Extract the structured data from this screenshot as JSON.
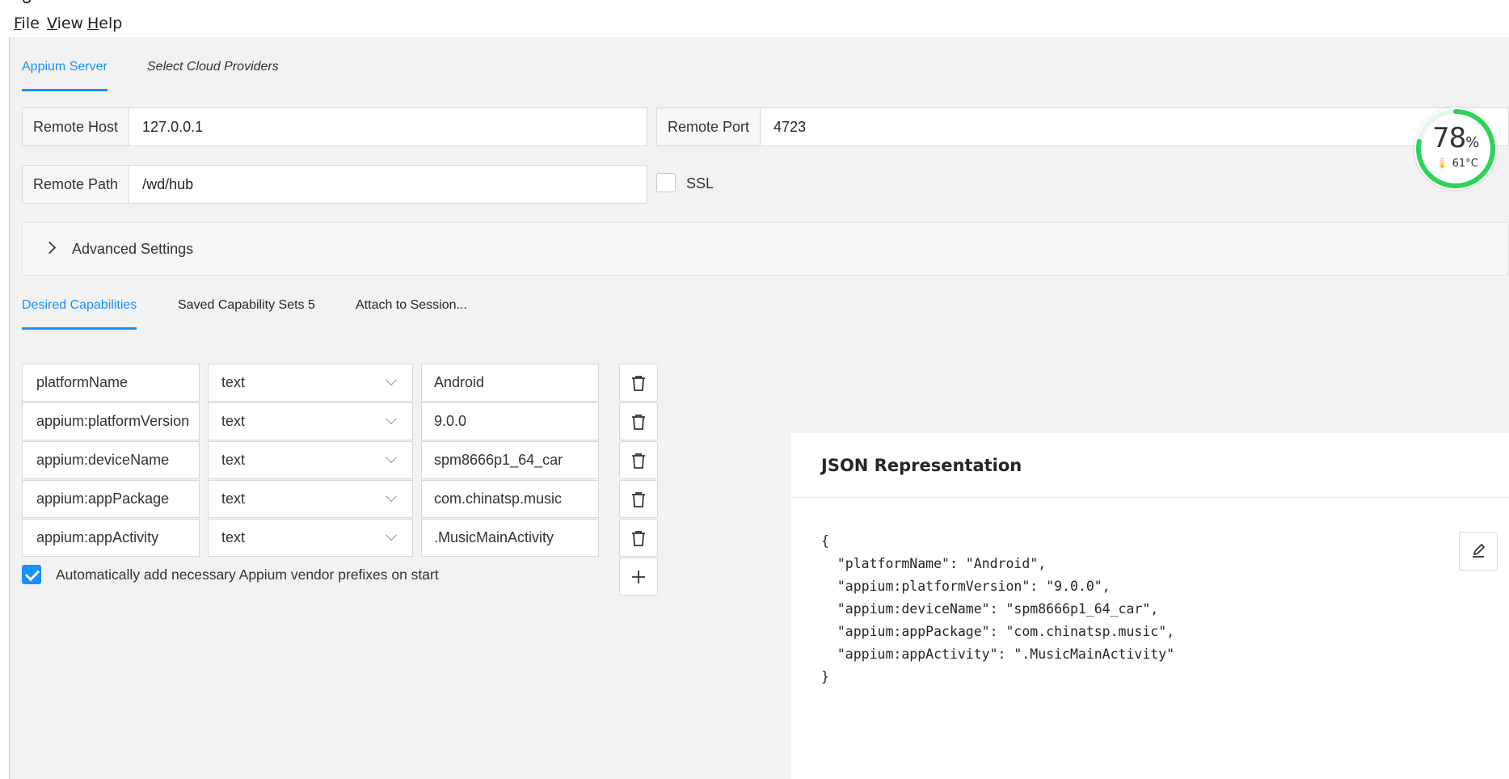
{
  "menu": {
    "file": "File",
    "view": "View",
    "help": "Help"
  },
  "server_tabs": [
    {
      "label": "Appium Server",
      "active": true
    },
    {
      "label": "Select Cloud Providers",
      "active": false
    }
  ],
  "server": {
    "remote_host_label": "Remote Host",
    "remote_host_value": "127.0.0.1",
    "remote_port_label": "Remote Port",
    "remote_port_value": "4723",
    "remote_path_label": "Remote Path",
    "remote_path_value": "/wd/hub",
    "ssl_label": "SSL",
    "ssl_checked": false,
    "advanced_label": "Advanced Settings"
  },
  "cap_tabs": [
    {
      "label": "Desired Capabilities",
      "active": true
    },
    {
      "label": "Saved Capability Sets 5",
      "active": false
    },
    {
      "label": "Attach to Session...",
      "active": false
    }
  ],
  "capabilities": [
    {
      "name": "platformName",
      "type": "text",
      "value": "Android"
    },
    {
      "name": "appium:platformVersion",
      "type": "text",
      "value": "9.0.0"
    },
    {
      "name": "appium:deviceName",
      "type": "text",
      "value": "spm8666p1_64_car"
    },
    {
      "name": "appium:appPackage",
      "type": "text",
      "value": "com.chinatsp.music"
    },
    {
      "name": "appium:appActivity",
      "type": "text",
      "value": ".MusicMainActivity"
    }
  ],
  "auto_prefix": {
    "label": "Automatically add necessary Appium vendor prefixes on start",
    "checked": true
  },
  "json_panel": {
    "title": "JSON Representation",
    "text": "{\n  \"platformName\": \"Android\",\n  \"appium:platformVersion\": \"9.0.0\",\n  \"appium:deviceName\": \"spm8666p1_64_car\",\n  \"appium:appPackage\": \"com.chinatsp.music\",\n  \"appium:appActivity\": \".MusicMainActivity\"\n}"
  },
  "gauge": {
    "percent": "78",
    "percent_unit": "%",
    "percent_value": 0.78,
    "temperature": "61°C"
  },
  "colors": {
    "accent": "#1890ff",
    "gauge": "#2fd35a"
  },
  "icons": {
    "delete": "trash-icon",
    "add": "plus-icon",
    "edit": "pencil-icon",
    "expand": "chevron-right-icon",
    "dropdown": "chevron-down-icon",
    "temperature": "thermometer-icon"
  }
}
